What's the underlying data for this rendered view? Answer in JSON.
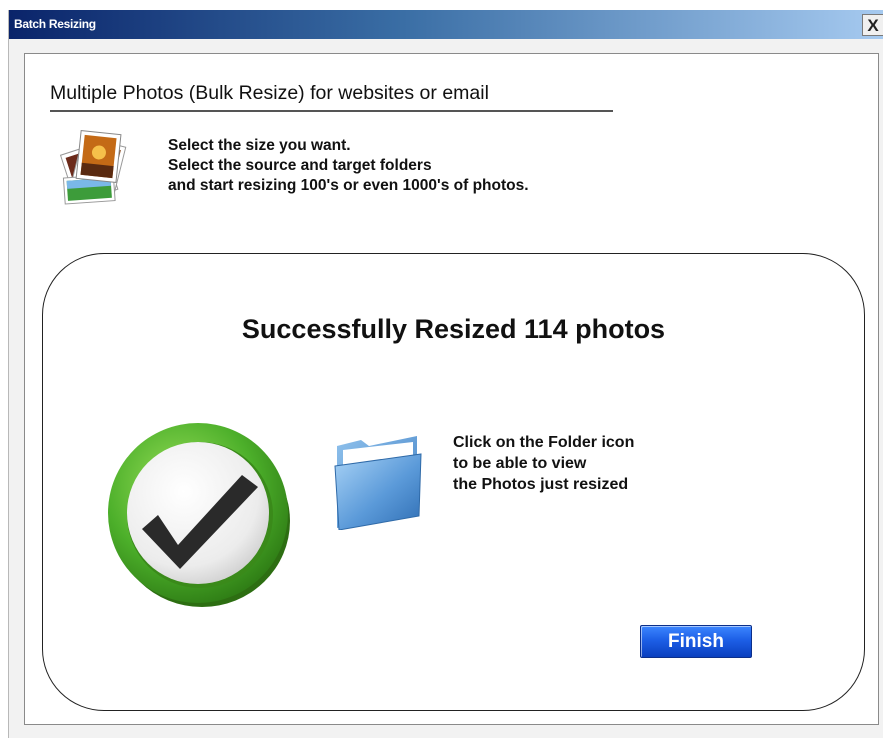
{
  "window": {
    "title": "Batch Resizing",
    "close_label": "X"
  },
  "header": {
    "heading": "Multiple Photos (Bulk Resize) for websites or email",
    "description_lines": [
      "Select the size you want.",
      "Select the source and target folders",
      "and start resizing 100's or even 1000's of photos."
    ],
    "icon": "photos-stack-icon"
  },
  "result": {
    "title": "Successfully Resized 114 photos",
    "status_icon": "checkmark-icon",
    "folder_icon": "folder-icon",
    "instruction_lines": [
      "Click on the Folder icon",
      "to be able to view",
      "the Photos just resized"
    ],
    "finish_label": "Finish"
  },
  "colors": {
    "title_bar": "#0a246a",
    "check_green": "#4caf2a",
    "finish_blue": "#1d5fe6"
  }
}
